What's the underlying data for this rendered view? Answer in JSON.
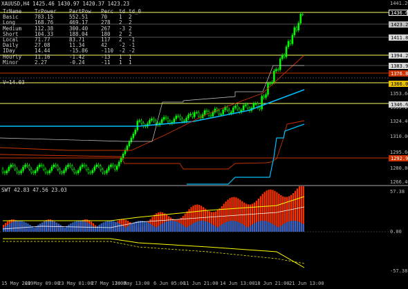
{
  "window": {
    "symbol_caption": "XAUUSD,H4  1425.46 1430.97 1420.37 1423.23"
  },
  "table": {
    "headers": [
      "TrName",
      "TrPower",
      "PartPow",
      "Perc",
      "td",
      "td_0"
    ],
    "rows": [
      [
        "Basic",
        "783.15",
        "552.51",
        "70",
        "1",
        "2"
      ],
      [
        "Long",
        "168.76",
        "469.17",
        "278",
        "2",
        "2"
      ],
      [
        "Medium",
        "112.38",
        "300.40",
        "267",
        "-3",
        "2"
      ],
      [
        "Short",
        "104.33",
        "188.04",
        "180",
        "2",
        "2"
      ],
      [
        "Local",
        "71.77",
        "83.71",
        "117",
        "2",
        "-1"
      ],
      [
        "Daily",
        "27.08",
        "11.34",
        "42",
        "-2",
        "-1"
      ],
      [
        "IDay",
        "14.44",
        "-15.86",
        "-110",
        "-2",
        "-2"
      ],
      [
        "Hourly",
        "11.16",
        "-1.42",
        "-13",
        "1",
        "1"
      ],
      [
        "Minor",
        "2.27",
        "-0.24",
        "-11",
        "1",
        "1"
      ]
    ],
    "v_label": "V=14.03"
  },
  "price_axis": {
    "tags": [
      {
        "value": "1436.60",
        "color": "#ffffff",
        "bg": "#000000",
        "border": "#ffffff"
      },
      {
        "value": "1423.23",
        "color": "#000000",
        "bg": "#c0c0c0",
        "border": "#c0c0c0"
      },
      {
        "value": "1411.86",
        "color": "#000000",
        "bg": "#d9d9d9",
        "border": "#d9d9d9"
      },
      {
        "value": "1394.21",
        "color": "#000000",
        "bg": "#d9d9d9",
        "border": "#d9d9d9"
      },
      {
        "value": "1383.97",
        "color": "#000000",
        "bg": "#d9d9d9",
        "border": "#d9d9d9"
      },
      {
        "value": "1376.83",
        "color": "#ffffff",
        "bg": "#cc3300",
        "border": "#cc3300"
      },
      {
        "value": "1366.00",
        "color": "#000000",
        "bg": "#e8c000",
        "border": "#e8c000"
      },
      {
        "value": "1346.64",
        "color": "#000000",
        "bg": "#d9d9d9",
        "border": "#d9d9d9"
      },
      {
        "value": "1292.91",
        "color": "#ffffff",
        "bg": "#cc3300",
        "border": "#cc3300"
      }
    ],
    "ticks": [
      "1441.20",
      "1353.60",
      "1339.20",
      "1324.40",
      "1310.00",
      "1295.60",
      "1280.80",
      "1266.40"
    ]
  },
  "sub_window": {
    "caption": "SWT 42.83 47.56 23.03",
    "ticks": [
      "57.38",
      "0.00",
      "-57.38"
    ]
  },
  "time_axis": {
    "labels": [
      "15 May 2019",
      "20 May 09:00",
      "23 May 01:00",
      "27 May 17:00",
      "30 May 13:00",
      "6 Jun 05:00",
      "11 Jun 21:00",
      "14 Jun 13:00",
      "18 Jun 21:00",
      "21 Jun 13:00"
    ]
  },
  "colors": {
    "background": "#000000",
    "bull_candle": "#00ff00",
    "level_line": "#ffff66",
    "cyan_line": "#00bfff",
    "red_line": "#cc3300",
    "histogram_red": "#ff3300",
    "histogram_blue": "#3366cc",
    "band_yellow": "#ffff00"
  }
}
